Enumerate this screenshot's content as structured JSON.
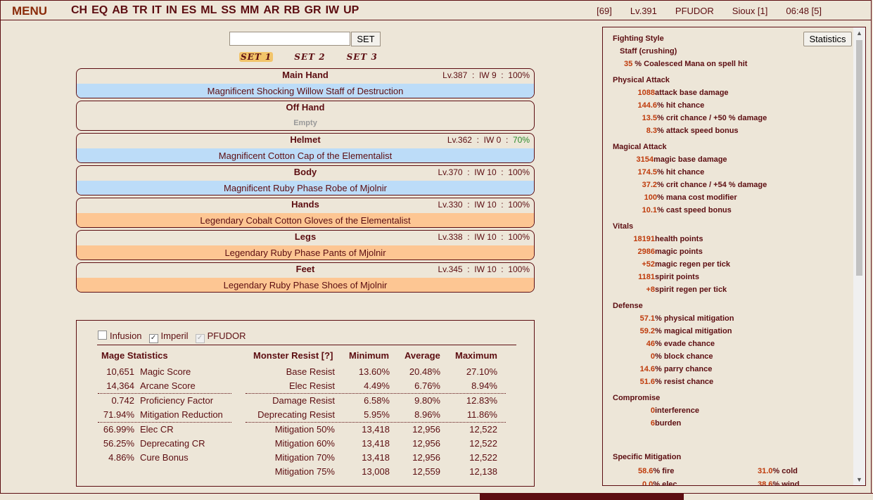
{
  "topbar": {
    "menu": "MENU",
    "nav": [
      "CH",
      "EQ",
      "AB",
      "TR",
      "IT",
      "IN",
      "ES",
      "ML",
      "SS",
      "MM",
      "AR",
      "RB",
      "GR",
      "IW",
      "UP"
    ],
    "status": {
      "bracket": "[69]",
      "level": "Lv.391",
      "name": "PFUDOR",
      "region": "Sioux [1]",
      "time": "06:48 [5]"
    }
  },
  "search": {
    "value": "",
    "button": "SET"
  },
  "set_tabs": [
    "SET 1",
    "SET 2",
    "SET 3"
  ],
  "equipment": [
    {
      "slot": "Main Hand",
      "lv": "Lv.387",
      "iw": "IW 9",
      "cond": "100%",
      "item": "Magnificent Shocking Willow Staff of Destruction",
      "color": "blue"
    },
    {
      "slot": "Off Hand",
      "lv": "",
      "iw": "",
      "cond": "",
      "item": "Empty",
      "color": "empty"
    },
    {
      "slot": "Helmet",
      "lv": "Lv.362",
      "iw": "IW 0",
      "cond": "70%",
      "item": "Magnificent Cotton Cap of the Elementalist",
      "color": "blue"
    },
    {
      "slot": "Body",
      "lv": "Lv.370",
      "iw": "IW 10",
      "cond": "100%",
      "item": "Magnificent Ruby Phase Robe of Mjolnir",
      "color": "blue"
    },
    {
      "slot": "Hands",
      "lv": "Lv.330",
      "iw": "IW 10",
      "cond": "100%",
      "item": "Legendary Cobalt Cotton Gloves of the Elementalist",
      "color": "orange"
    },
    {
      "slot": "Legs",
      "lv": "Lv.338",
      "iw": "IW 10",
      "cond": "100%",
      "item": "Legendary Ruby Phase Pants of Mjolnir",
      "color": "orange"
    },
    {
      "slot": "Feet",
      "lv": "Lv.345",
      "iw": "IW 10",
      "cond": "100%",
      "item": "Legendary Ruby Phase Shoes of Mjolnir",
      "color": "orange"
    }
  ],
  "checks": [
    {
      "label": "Infusion",
      "checked": false
    },
    {
      "label": "Imperil",
      "checked": true
    },
    {
      "label": "PFUDOR",
      "checked": true
    }
  ],
  "mage_stats": {
    "header": "Mage Statistics",
    "rows": [
      {
        "v": "10,651",
        "l": "Magic Score"
      },
      {
        "v": "14,364",
        "l": "Arcane Score"
      },
      {
        "v": "0.742",
        "l": "Proficiency Factor"
      },
      {
        "v": "71.94%",
        "l": "Mitigation Reduction"
      },
      {
        "v": "66.99%",
        "l": "Elec CR"
      },
      {
        "v": "56.25%",
        "l": "Deprecating CR"
      },
      {
        "v": "4.86%",
        "l": "Cure Bonus"
      }
    ]
  },
  "resist": {
    "headers": [
      "Monster Resist [?]",
      "Minimum",
      "Average",
      "Maximum"
    ],
    "rows": [
      {
        "l": "Base Resist",
        "min": "13.60%",
        "avg": "20.48%",
        "max": "27.10%"
      },
      {
        "l": "Elec Resist",
        "min": "4.49%",
        "avg": "6.76%",
        "max": "8.94%"
      },
      {
        "l": "Damage Resist",
        "min": "6.58%",
        "avg": "9.80%",
        "max": "12.83%"
      },
      {
        "l": "Deprecating Resist",
        "min": "5.95%",
        "avg": "8.96%",
        "max": "11.86%"
      },
      {
        "l": "Mitigation 50%",
        "min": "13,418",
        "avg": "12,956",
        "max": "12,522"
      },
      {
        "l": "Mitigation 60%",
        "min": "13,418",
        "avg": "12,956",
        "max": "12,522"
      },
      {
        "l": "Mitigation 70%",
        "min": "13,418",
        "avg": "12,956",
        "max": "12,522"
      },
      {
        "l": "Mitigation 75%",
        "min": "13,008",
        "avg": "12,559",
        "max": "12,138"
      }
    ]
  },
  "right_panel": {
    "button": "Statistics",
    "fighting_style": {
      "title": "Fighting Style",
      "style": "Staff (crushing)",
      "v": "35",
      "t": " % Coalesced Mana on spell hit"
    },
    "sections": [
      {
        "title": "Physical Attack",
        "lines": [
          {
            "v": "1088",
            "t": " attack base damage"
          },
          {
            "v": "144.6",
            "t": " % hit chance"
          },
          {
            "v": "13.5",
            "t": " % crit chance / +50 % damage"
          },
          {
            "v": "8.3",
            "t": " % attack speed bonus"
          }
        ]
      },
      {
        "title": "Magical Attack",
        "lines": [
          {
            "v": "3154",
            "t": " magic base damage"
          },
          {
            "v": "174.5",
            "t": " % hit chance"
          },
          {
            "v": "37.2",
            "t": " % crit chance / +54 % damage"
          },
          {
            "v": "100",
            "t": " % mana cost modifier"
          },
          {
            "v": "10.1",
            "t": " % cast speed bonus"
          }
        ]
      },
      {
        "title": "Vitals",
        "lines": [
          {
            "v": "18191",
            "t": " health points"
          },
          {
            "v": "2986",
            "t": " magic points"
          },
          {
            "v": "+52",
            "t": " magic regen per tick"
          },
          {
            "v": "1181",
            "t": " spirit points"
          },
          {
            "v": "+8",
            "t": " spirit regen per tick"
          }
        ]
      },
      {
        "title": "Defense",
        "lines": [
          {
            "v": "57.1",
            "t": " % physical mitigation"
          },
          {
            "v": "59.2",
            "t": " % magical mitigation"
          },
          {
            "v": "46",
            "t": " % evade chance"
          },
          {
            "v": "0",
            "t": " % block chance"
          },
          {
            "v": "14.6",
            "t": " % parry chance"
          },
          {
            "v": "51.6",
            "t": " % resist chance"
          }
        ]
      },
      {
        "title": "Compromise",
        "lines": [
          {
            "v": "0",
            "t": " interference"
          },
          {
            "v": "6",
            "t": " burden"
          }
        ]
      }
    ],
    "specific": {
      "title": "Specific Mitigation",
      "items": [
        {
          "v": "58.6",
          "t": "% fire"
        },
        {
          "v": "31.0",
          "t": "% cold"
        },
        {
          "v": "0.0",
          "t": "% elec"
        },
        {
          "v": "38.6",
          "t": "% wind"
        }
      ]
    }
  }
}
